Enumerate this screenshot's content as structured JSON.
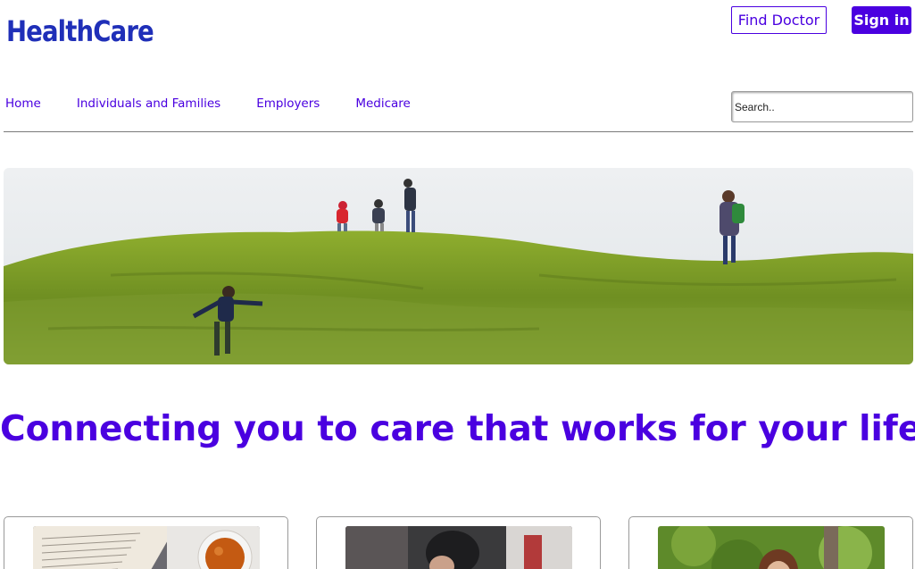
{
  "brand": {
    "logo_text": "HealthCare"
  },
  "header": {
    "find_doctor_label": "Find Doctor",
    "sign_in_label": "Sign in"
  },
  "nav": {
    "items": [
      {
        "label": "Home"
      },
      {
        "label": "Individuals and Families"
      },
      {
        "label": "Employers"
      },
      {
        "label": "Medicare"
      }
    ]
  },
  "search": {
    "placeholder": "Search..",
    "value": ""
  },
  "hero": {
    "image": "family-hiking-grassy-hill"
  },
  "headline": {
    "text": "Connecting you to care that works for your life"
  },
  "cards": [
    {
      "image": "book-and-tea"
    },
    {
      "image": "person-portrait"
    },
    {
      "image": "woman-in-park"
    }
  ],
  "colors": {
    "accent": "#4a00e0",
    "logo": "#1f2fb8",
    "grass": "#7a9a2a",
    "sky": "#e8ecef"
  }
}
